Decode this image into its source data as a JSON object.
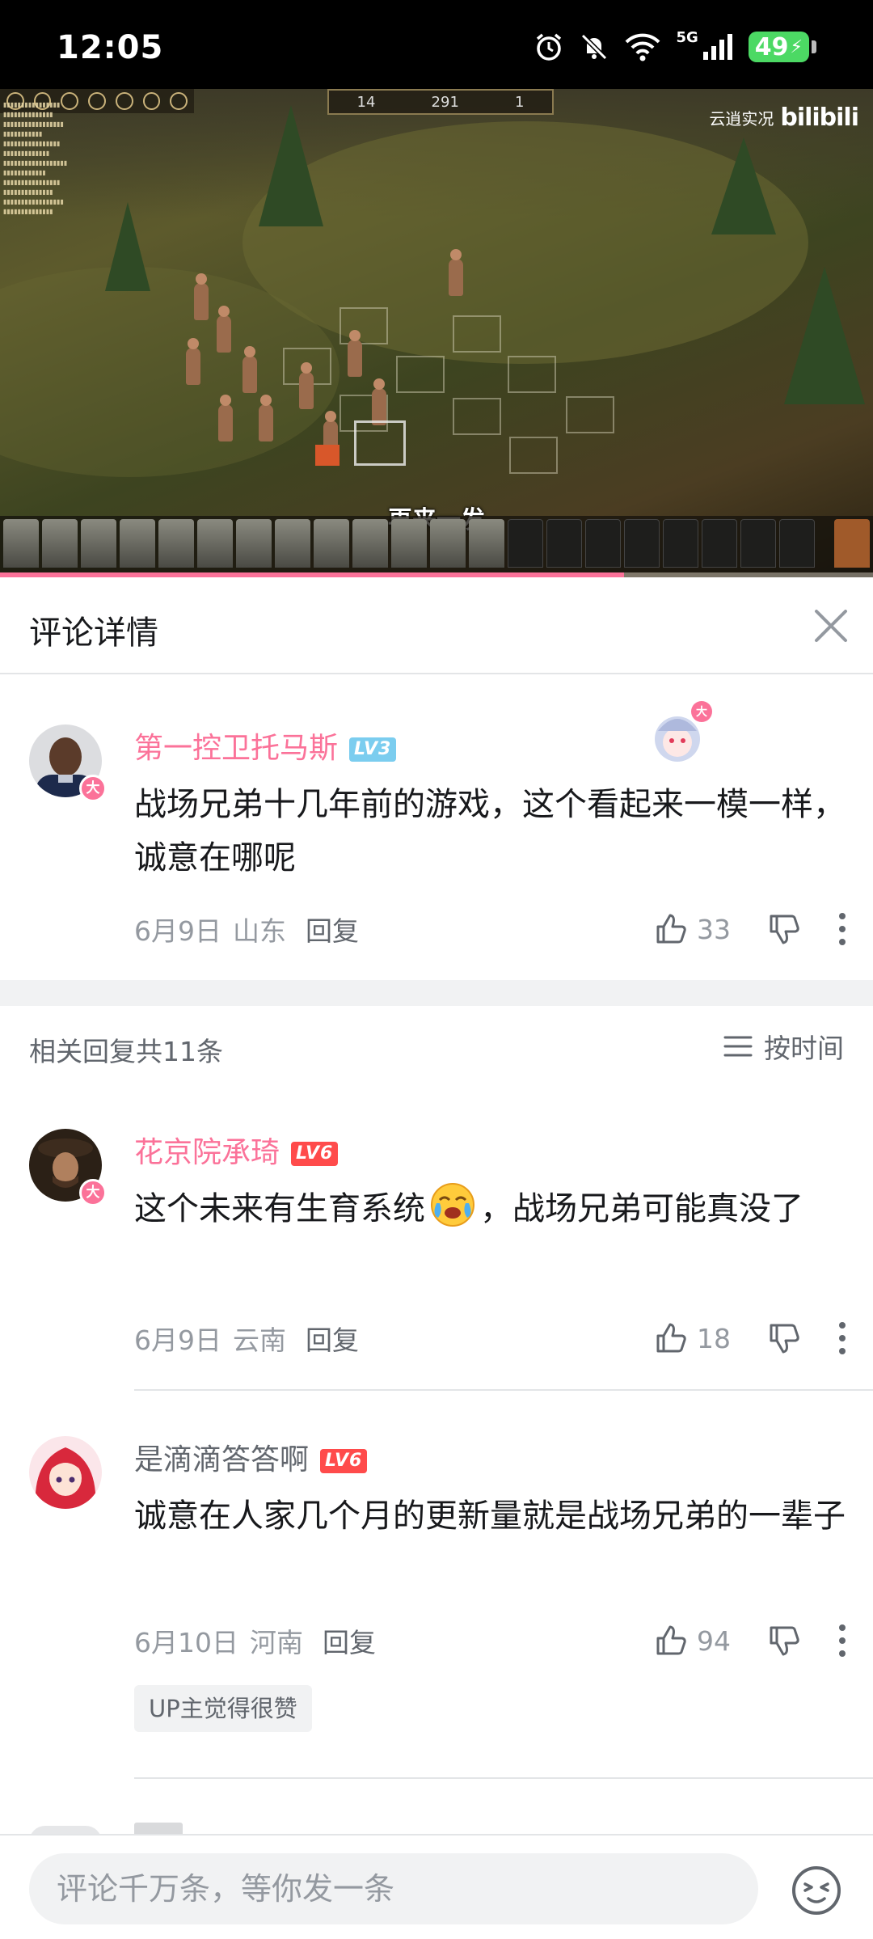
{
  "status_bar": {
    "time": "12:05",
    "network": "5G",
    "battery": "49",
    "icons": [
      "alarm-icon",
      "mute-bell-icon",
      "wifi-icon",
      "signal-icon",
      "battery-charging-icon"
    ]
  },
  "video": {
    "watermark_text": "云逍实况",
    "watermark_logo": "bilibili",
    "subtitle": "再来一发",
    "hud": [
      "14",
      "291",
      "1"
    ],
    "progress": 0.715
  },
  "panel": {
    "title": "评论详情",
    "close_icon": "close-icon"
  },
  "root_comment": {
    "username": "第一控卫托马斯",
    "level": "LV3",
    "text": "战场兄弟十几年前的游戏，这个看起来一模一样，诚意在哪呢",
    "date": "6月9日",
    "location": "山东",
    "reply_label": "回复",
    "likes": "33"
  },
  "related": {
    "count_label": "相关回复共11条",
    "sort_label": "按时间"
  },
  "replies": [
    {
      "username": "花京院承琦",
      "level": "LV6",
      "text_before": "这个未来有生育系统",
      "emoji": "face-tears-emoji",
      "text_after": "，战场兄弟可能真没了",
      "date": "6月9日",
      "location": "云南",
      "reply_label": "回复",
      "likes": "18"
    },
    {
      "username": "是滴滴答答啊",
      "level": "LV6",
      "text": "诚意在人家几个月的更新量就是战场兄弟的一辈子",
      "date": "6月10日",
      "location": "河南",
      "reply_label": "回复",
      "likes": "94",
      "up_tag": "UP主觉得很赞"
    }
  ],
  "bottom_bar": {
    "placeholder": "评论千万条，等你发一条",
    "emoji_icon": "emoji-icon"
  },
  "colors": {
    "accent_pink": "#fb7299",
    "lv3": "#7bcdef",
    "lv6": "#ff4b4b",
    "text_secondary": "#9499a0"
  }
}
